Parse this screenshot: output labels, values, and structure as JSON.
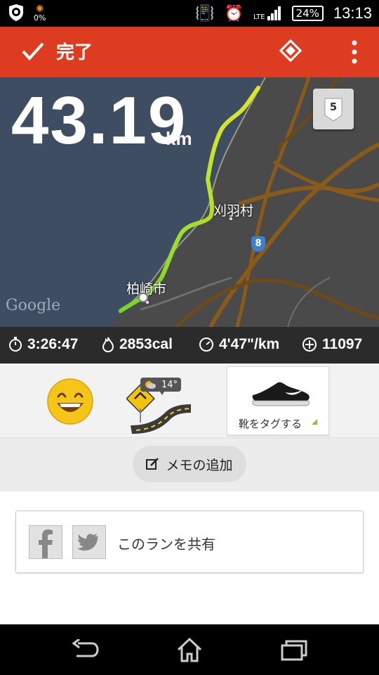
{
  "status_bar": {
    "battery_saver": "0%",
    "network": "LTE",
    "battery": "24%",
    "time": "13:13"
  },
  "app_bar": {
    "done_label": "完了",
    "icons": [
      "check-icon",
      "diamond-icon",
      "overflow-menu-icon"
    ]
  },
  "map": {
    "distance": "43.19",
    "unit": "km",
    "badge": "5",
    "watermark": "Google",
    "labels": {
      "village": "刈羽村",
      "city": "柏崎市",
      "route": "8"
    },
    "colors": {
      "sea": "#3f4d63",
      "land": "#4a4a4a",
      "road": "#8a5a18",
      "route_start": "#74d62c",
      "route_end": "#dde62a"
    }
  },
  "stats": {
    "duration": "3:26:47",
    "calories": "2853cal",
    "pace": "4'47\"/km",
    "fuel": "11097"
  },
  "tags": {
    "weather_temp": "14°",
    "shoe_label": "靴をタグする"
  },
  "memo": {
    "label": "メモの追加"
  },
  "share": {
    "label": "このランを共有"
  },
  "colors": {
    "accent": "#dd3c21",
    "stats_bg": "#2b2b2b"
  }
}
